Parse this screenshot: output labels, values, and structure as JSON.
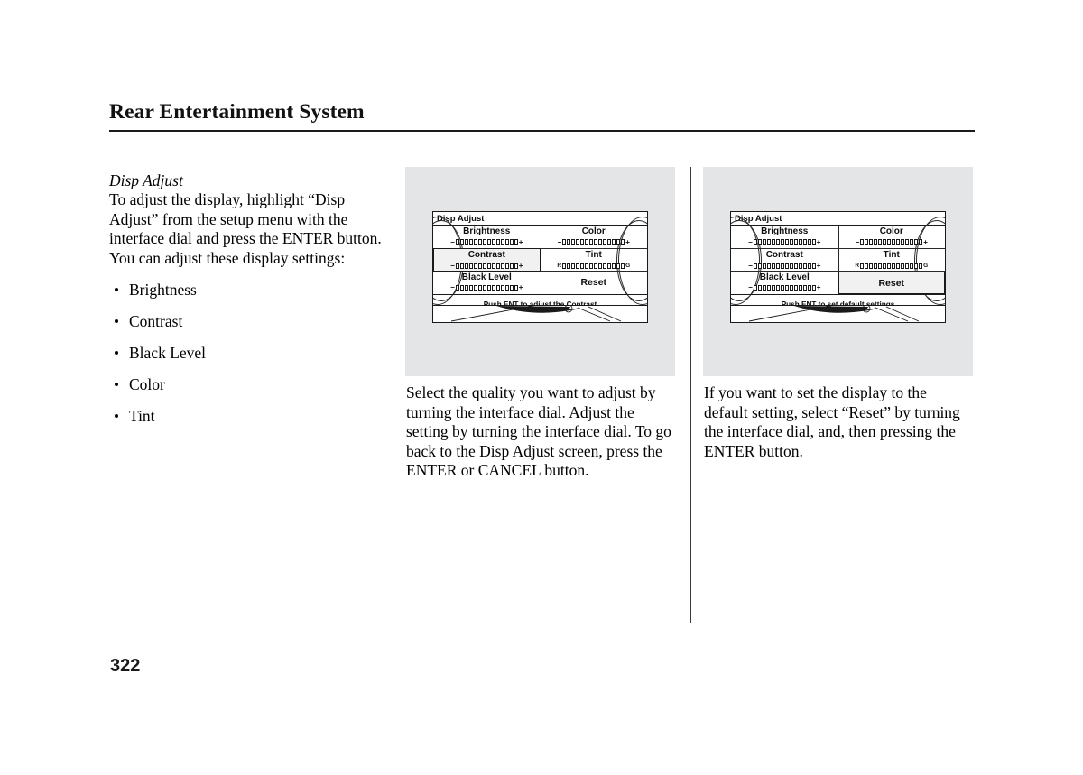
{
  "header": {
    "title": "Rear Entertainment System"
  },
  "page_number": "322",
  "left_column": {
    "subhead": "Disp Adjust",
    "paragraph": "To adjust the display, highlight “Disp Adjust” from the setup menu with the interface dial and press the ENTER button. You can adjust these display settings:",
    "bullets": [
      {
        "label": "Brightness"
      },
      {
        "label": "Contrast"
      },
      {
        "label": "Black Level"
      },
      {
        "label": "Tint"
      },
      {
        "label": "Color"
      }
    ],
    "bullet_list": [
      "Brightness",
      "Contrast",
      "Black Level",
      "Color",
      "Tint"
    ]
  },
  "figures": [
    {
      "screen_title": "Disp Adjust",
      "left_items": [
        {
          "label": "Brightness",
          "minus": "−",
          "plus": "+",
          "segments": 14,
          "selected": false
        },
        {
          "label": "Contrast",
          "minus": "−",
          "plus": "+",
          "segments": 14,
          "selected": true
        },
        {
          "label": "Black Level",
          "minus": "−",
          "plus": "+",
          "segments": 14,
          "selected": false
        }
      ],
      "right_items": [
        {
          "label": "Color",
          "minus": "−",
          "plus": "+",
          "segments": 14,
          "selected": false
        },
        {
          "label": "Tint",
          "minus": "R",
          "plus": "G",
          "segments": 14,
          "selected": false
        },
        {
          "label": "Reset",
          "minus": "",
          "plus": "",
          "segments": 0,
          "selected": false
        }
      ],
      "hint": "Push ENT to adjust the Contrast"
    },
    {
      "screen_title": "Disp Adjust",
      "left_items": [
        {
          "label": "Brightness",
          "minus": "−",
          "plus": "+",
          "segments": 14,
          "selected": false
        },
        {
          "label": "Contrast",
          "minus": "−",
          "plus": "+",
          "segments": 14,
          "selected": false
        },
        {
          "label": "Black Level",
          "minus": "−",
          "plus": "+",
          "segments": 14,
          "selected": false
        }
      ],
      "right_items": [
        {
          "label": "Color",
          "minus": "−",
          "plus": "+",
          "segments": 14,
          "selected": false
        },
        {
          "label": "Tint",
          "minus": "R",
          "plus": "G",
          "segments": 14,
          "selected": false
        },
        {
          "label": "Reset",
          "minus": "",
          "plus": "",
          "segments": 0,
          "selected": true
        }
      ],
      "hint": "Push ENT to set default settings"
    }
  ],
  "captions": {
    "middle": "Select the quality you want to adjust by turning the interface dial. Adjust the setting by turning the interface dial. To go back to the Disp Adjust screen, press the ENTER or CANCEL button.",
    "right": "If you want to set the display to the default setting, select “Reset” by turning the interface dial, and, then pressing the ENTER button."
  },
  "colors": {
    "panel_gray": "#e4e5e7",
    "ink": "#1a1a1a",
    "paper": "#ffffff"
  }
}
